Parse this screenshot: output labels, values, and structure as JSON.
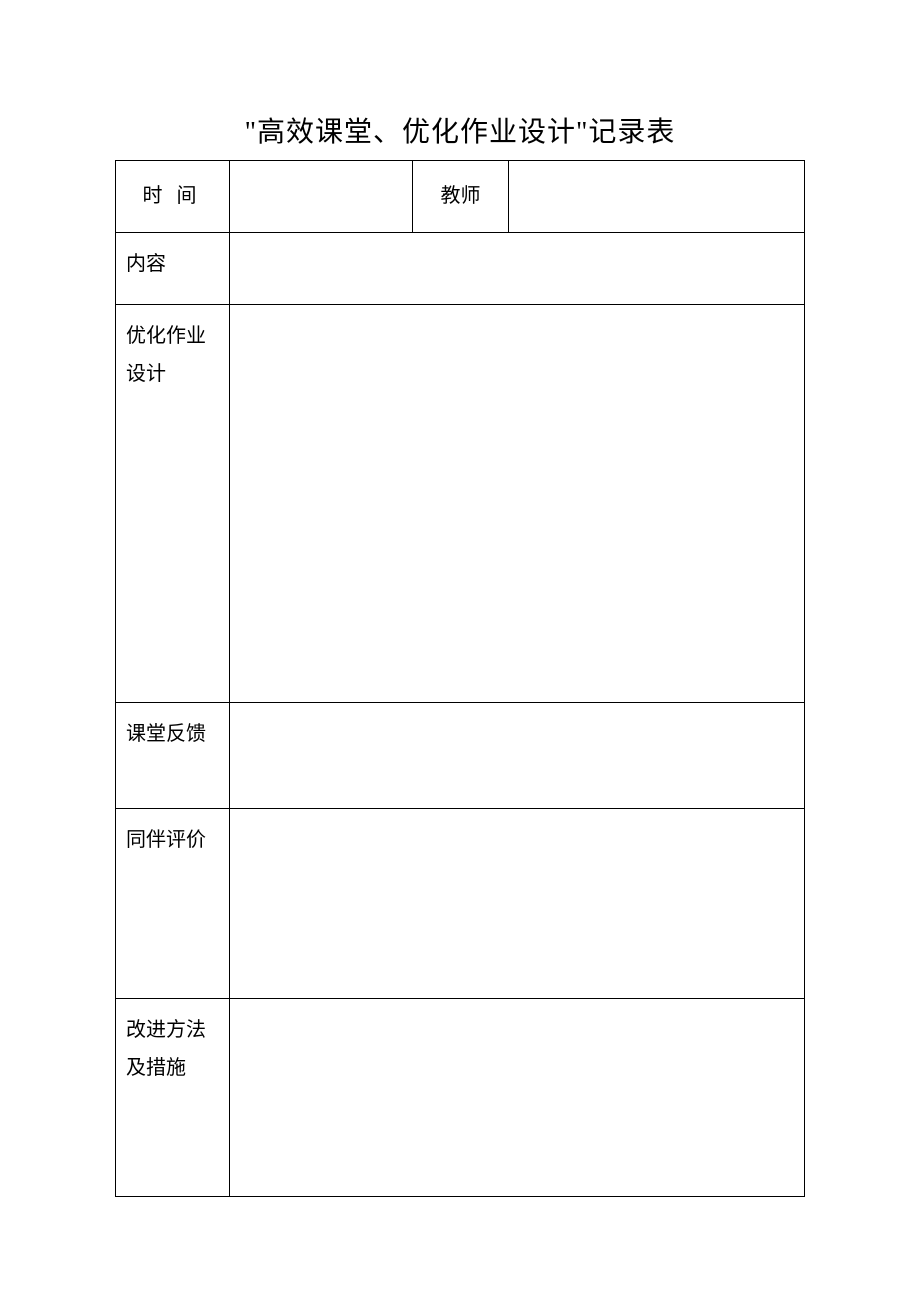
{
  "title": "\"高效课堂、优化作业设计\"记录表",
  "rows": {
    "time": {
      "label": "时间",
      "value": ""
    },
    "teacher": {
      "label": "教师",
      "value": ""
    },
    "content": {
      "label": "内容",
      "value": ""
    },
    "homework_design": {
      "label": "优化作业设计",
      "value": ""
    },
    "class_feedback": {
      "label": "课堂反馈",
      "value": ""
    },
    "peer_evaluation": {
      "label": "同伴评价",
      "value": ""
    },
    "improvement": {
      "label": "改进方法及措施",
      "value": ""
    }
  }
}
